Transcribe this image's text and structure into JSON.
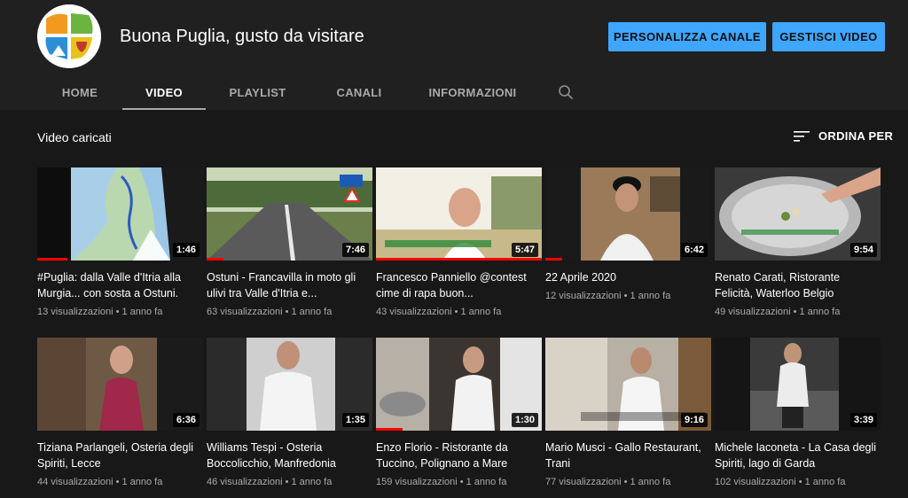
{
  "channel": {
    "title": "Buona Puglia, gusto da visitare",
    "customize_label": "PERSONALIZZA CANALE",
    "manage_label": "GESTISCI VIDEO"
  },
  "tabs": [
    {
      "label": "HOME"
    },
    {
      "label": "VIDEO",
      "active": true
    },
    {
      "label": "PLAYLIST"
    },
    {
      "label": "CANALI"
    },
    {
      "label": "INFORMAZIONI"
    }
  ],
  "section": {
    "title": "Video caricati",
    "sort_label": "ORDINA PER"
  },
  "videos": [
    {
      "title": "#Puglia: dalla Valle d'Itria alla Murgia... con sosta a Ostuni.",
      "duration": "1:46",
      "views": "13 visualizzazioni",
      "age": "1 anno fa",
      "watched": 0.18
    },
    {
      "title": "Ostuni - Francavilla in moto gli ulivi tra Valle d'Itria e...",
      "duration": "7:46",
      "views": "63 visualizzazioni",
      "age": "1 anno fa",
      "watched": 0.1
    },
    {
      "title": "Francesco Panniello @contest cime di rapa buon...",
      "duration": "5:47",
      "views": "43 visualizzazioni",
      "age": "1 anno fa",
      "watched": 1.0
    },
    {
      "title": "22 Aprile 2020",
      "duration": "6:42",
      "views": "12 visualizzazioni",
      "age": "1 anno fa",
      "watched": 0.1
    },
    {
      "title": "Renato Carati, Ristorante Felicità, Waterloo Belgio",
      "duration": "9:54",
      "views": "49 visualizzazioni",
      "age": "1 anno fa",
      "watched": 0
    },
    {
      "title": "Tiziana Parlangeli, Osteria degli Spiriti, Lecce",
      "duration": "6:36",
      "views": "44 visualizzazioni",
      "age": "1 anno fa",
      "watched": 0
    },
    {
      "title": "Williams Tespi - Osteria Boccolicchio, Manfredonia",
      "duration": "1:35",
      "views": "46 visualizzazioni",
      "age": "1 anno fa",
      "watched": 0
    },
    {
      "title": "Enzo Florio - Ristorante da Tuccino, Polignano a Mare",
      "duration": "1:30",
      "views": "159 visualizzazioni",
      "age": "1 anno fa",
      "watched": 0.16
    },
    {
      "title": "Mario Musci - Gallo Restaurant, Trani",
      "duration": "9:16",
      "views": "77 visualizzazioni",
      "age": "1 anno fa",
      "watched": 0
    },
    {
      "title": "Michele Iaconeta - La Casa degli Spiriti, lago di Garda",
      "duration": "3:39",
      "views": "102 visualizzazioni",
      "age": "1 anno fa",
      "watched": 0
    }
  ],
  "colors": {
    "accent": "#3ea6ff",
    "progress": "#ff0000",
    "background": "#181818",
    "header": "#202020"
  }
}
